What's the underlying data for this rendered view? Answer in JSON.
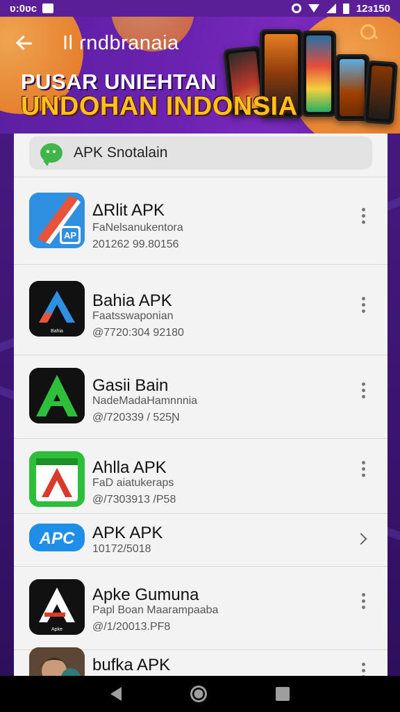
{
  "status_bar": {
    "time": "ʋ:0ʋc",
    "right_text": "12ɜ150"
  },
  "header": {
    "title": "Il ɾndbranaia",
    "banner_line1": "PUSAR UNIEHTAN",
    "banner_line2": "UNDOHAN INDONSIA"
  },
  "search": {
    "label": "APK Snotalain"
  },
  "items": [
    {
      "title": "ΔRlit APK",
      "subtitle": "FaNelsanukentora",
      "date": "201262 99.80156",
      "action": "more"
    },
    {
      "title": "Bahia APK",
      "subtitle": "Faatsswaponian",
      "date": "@7720:304 92180",
      "action": "more"
    },
    {
      "title": "Gasii Bain",
      "subtitle": "NadeMadaHamnnnia",
      "date": "@/720339 / 525Ɲ",
      "action": "more"
    },
    {
      "title": "Ahlla APK",
      "subtitle": "FaD aiatukeraps",
      "date": "@/7303913 /P58",
      "action": "more"
    },
    {
      "title": "APK APK",
      "subtitle": "",
      "date": "10172/5018",
      "action": "open"
    },
    {
      "title": "Apke Gumuna",
      "subtitle": "Papl Boan Maarampaaba",
      "date": "@/1/20013.PF8",
      "action": "more"
    },
    {
      "title": "bufka APK",
      "subtitle": "",
      "date": "",
      "action": "more"
    }
  ],
  "icons": {
    "item0": "ap-icon",
    "item1": "a-triangle-icon",
    "item2": "green-a-icon",
    "item3": "red-a-icon",
    "item4": "apc-icon",
    "item5": "white-a-icon",
    "item6": "avatar-photo-icon"
  },
  "colors": {
    "header_purple": "#6b22b0",
    "banner_yellow": "#ffc21a",
    "accent_green": "#3fb54a"
  }
}
